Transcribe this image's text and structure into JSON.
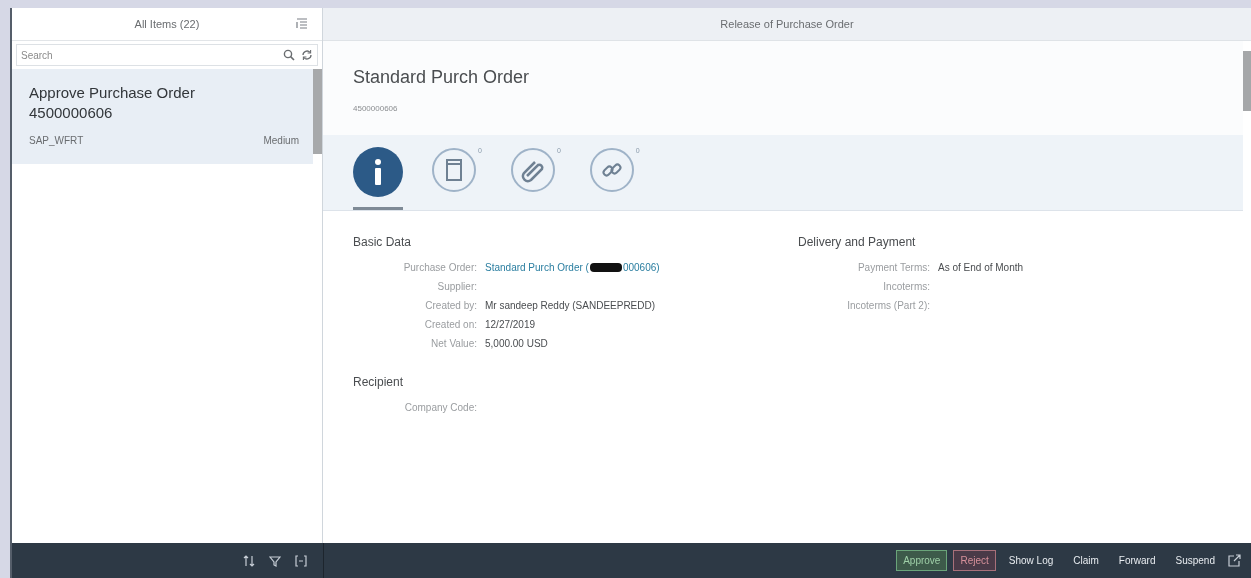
{
  "master": {
    "title": "All Items (22)",
    "search": {
      "placeholder": "Search"
    },
    "items": [
      {
        "title": "Approve Purchase Order 4500000606",
        "created_by": "SAP_WFRT",
        "priority": "Medium",
        "selected": true
      }
    ]
  },
  "detail": {
    "title": "Release of Purchase Order",
    "object_title": "Standard Purch Order",
    "object_number": "4500000606",
    "tabs": [
      {
        "kind": "info",
        "selected": true
      },
      {
        "kind": "notes",
        "count": "0",
        "selected": false
      },
      {
        "kind": "attachments",
        "count": "0",
        "selected": false
      },
      {
        "kind": "links",
        "count": "0",
        "selected": false
      }
    ],
    "sections": [
      {
        "title": "Basic Data",
        "fields": [
          {
            "label": "Purchase Order:",
            "kind": "link",
            "value": "Standard Purch Order (",
            "value_after": "000606)",
            "redacted": true
          },
          {
            "label": "Supplier:",
            "kind": "text"
          },
          {
            "label": "Created by:",
            "kind": "text",
            "value": "Mr sandeep Reddy (SANDEEPREDD)"
          },
          {
            "label": "Created on:",
            "kind": "text",
            "value": "12/27/2019"
          },
          {
            "label": "Net Value:",
            "kind": "text",
            "value": "5,000.00 USD"
          }
        ]
      },
      {
        "title": "Delivery and Payment",
        "fields": [
          {
            "label": "Payment Terms:",
            "kind": "text",
            "value": "As of End of Month"
          },
          {
            "label": "Incoterms:",
            "kind": "text"
          },
          {
            "label": "Incoterms (Part 2):",
            "kind": "text"
          }
        ]
      },
      {
        "title": "Recipient",
        "fields": [
          {
            "label": "Company Code:",
            "kind": "text"
          }
        ]
      }
    ]
  },
  "footer": {
    "actions": [
      {
        "label": "Approve",
        "kind": "accept"
      },
      {
        "label": "Reject",
        "kind": "reject"
      },
      {
        "label": "Show Log",
        "kind": "plain"
      },
      {
        "label": "Claim",
        "kind": "plain"
      },
      {
        "label": "Forward",
        "kind": "plain"
      },
      {
        "label": "Suspend",
        "kind": "plain"
      }
    ]
  }
}
